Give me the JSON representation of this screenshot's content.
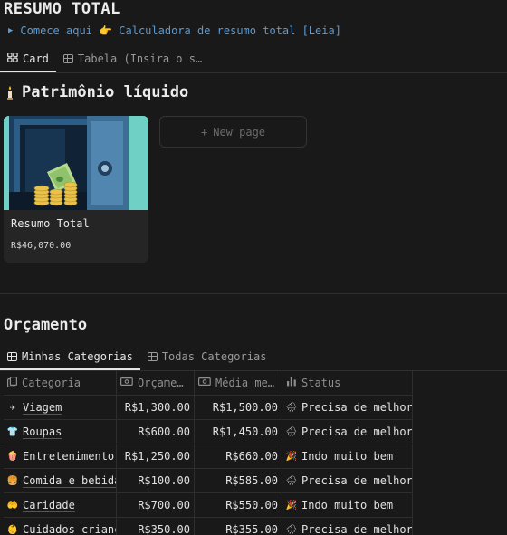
{
  "page": {
    "title": "RESUMO TOTAL"
  },
  "toggle": {
    "label": "Comece aqui 👉 Calculadora de resumo total [Leia]"
  },
  "view_tabs": [
    {
      "label": "Card",
      "active": true,
      "icon": "gallery-icon"
    },
    {
      "label": "Tabela (Insira o s…",
      "active": false,
      "icon": "table-icon"
    }
  ],
  "patrimonio": {
    "heading": "Patrimônio líquido",
    "icon": "candle-icon",
    "card": {
      "title": "Resumo Total",
      "value": "R$46,070.00",
      "image": "vault-with-money-image"
    },
    "new_page_label": "New page"
  },
  "orcamento": {
    "heading": "Orçamento",
    "tabs": [
      {
        "label": "Minhas Categorias",
        "active": true,
        "icon": "table-icon"
      },
      {
        "label": "Todas Categorias",
        "active": false,
        "icon": "table-icon"
      }
    ],
    "columns": [
      {
        "label": "Categoria",
        "icon": "copy-icon"
      },
      {
        "label": "Orçame…",
        "icon": "money-icon"
      },
      {
        "label": "Média me…",
        "icon": "money-icon"
      },
      {
        "label": "Status",
        "icon": "bar-chart-icon"
      }
    ],
    "rows": [
      {
        "icon": "plane-icon",
        "emoji": "✈",
        "emoji_color": "#4a90d9",
        "categoria": "Viagem",
        "orcamento": "R$1,300.00",
        "media": "R$1,500.00",
        "status_icon": "rain-cloud-icon",
        "status_glyph": "🌧",
        "status": "Precisa de melhorar"
      },
      {
        "icon": "shirt-icon",
        "emoji": "👕",
        "emoji_color": "#c9c9c9",
        "categoria": "Roupas",
        "orcamento": "R$600.00",
        "media": "R$1,450.00",
        "status_icon": "rain-cloud-icon",
        "status_glyph": "🌧",
        "status": "Precisa de melhorar"
      },
      {
        "icon": "popcorn-icon",
        "emoji": "🍿",
        "emoji_color": "#e0c080",
        "categoria": "Entretenimento",
        "orcamento": "R$1,250.00",
        "media": "R$660.00",
        "status_icon": "party-popper-icon",
        "status_glyph": "🎉",
        "status": "Indo muito bem"
      },
      {
        "icon": "food-icon",
        "emoji": "🍔",
        "emoji_color": "#d9a050",
        "categoria": "Comida e bebida",
        "orcamento": "R$100.00",
        "media": "R$585.00",
        "status_icon": "rain-cloud-icon",
        "status_glyph": "🌧",
        "status": "Precisa de melhorar"
      },
      {
        "icon": "charity-icon",
        "emoji": "🤲",
        "emoji_color": "#d98050",
        "categoria": "Caridade",
        "orcamento": "R$700.00",
        "media": "R$550.00",
        "status_icon": "party-popper-icon",
        "status_glyph": "🎉",
        "status": "Indo muito bem"
      },
      {
        "icon": "child-care-icon",
        "emoji": "👶",
        "emoji_color": "#e0b090",
        "categoria": "Cuidados crianças",
        "orcamento": "R$350.00",
        "media": "R$355.00",
        "status_icon": "rain-cloud-icon",
        "status_glyph": "🌧",
        "status": "Precisa de melhorar"
      }
    ]
  }
}
